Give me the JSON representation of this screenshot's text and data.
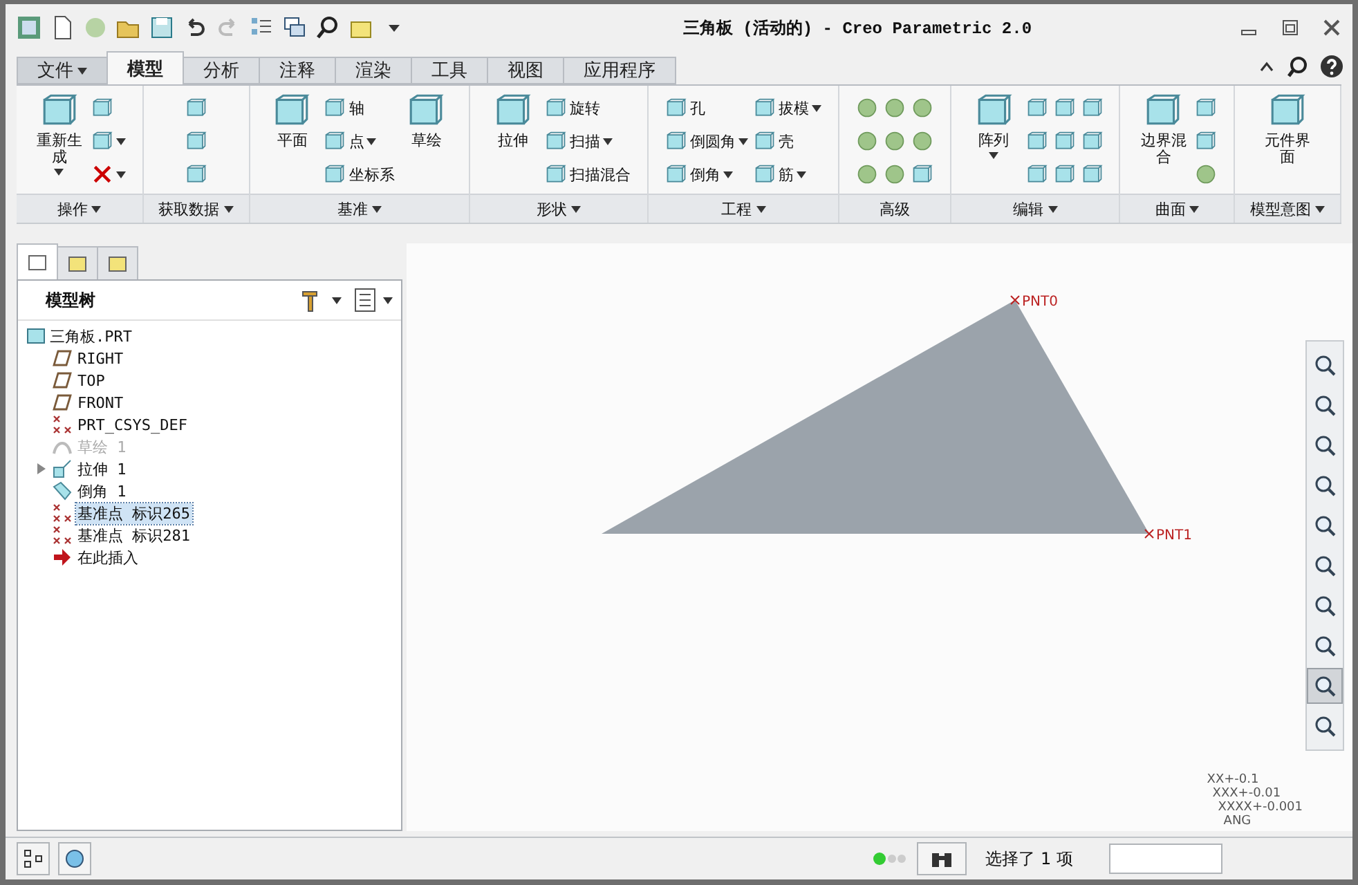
{
  "window": {
    "title": "三角板 (活动的) - Creo Parametric 2.0"
  },
  "menu_tabs": [
    {
      "label": "文件",
      "kind": "menu",
      "selected": false
    },
    {
      "label": "模型",
      "kind": "tab",
      "selected": true
    },
    {
      "label": "分析",
      "kind": "tab",
      "selected": false
    },
    {
      "label": "注释",
      "kind": "tab",
      "selected": false
    },
    {
      "label": "渲染",
      "kind": "tab",
      "selected": false
    },
    {
      "label": "工具",
      "kind": "tab",
      "selected": false
    },
    {
      "label": "视图",
      "kind": "tab",
      "selected": false
    },
    {
      "label": "应用程序",
      "kind": "tab",
      "selected": false
    }
  ],
  "ribbon_groups": [
    {
      "label": "操作",
      "dropdown": true,
      "items": [
        {
          "kind": "large",
          "label": "重新生成",
          "dropdown": true
        },
        {
          "kind": "icon",
          "dropdown": false
        },
        {
          "kind": "icon",
          "dropdown": true
        },
        {
          "kind": "delete",
          "dropdown": true
        }
      ]
    },
    {
      "label": "获取数据",
      "dropdown": true,
      "items": [
        {
          "kind": "icon",
          "dropdown": false
        },
        {
          "kind": "icon",
          "dropdown": false
        },
        {
          "kind": "icon",
          "dropdown": false
        }
      ]
    },
    {
      "label": "基准",
      "dropdown": true,
      "items": [
        {
          "kind": "large",
          "label": "平面",
          "dropdown": false
        },
        {
          "kind": "small",
          "label": "轴",
          "dropdown": false
        },
        {
          "kind": "small",
          "label": "点",
          "dropdown": true
        },
        {
          "kind": "small",
          "label": "坐标系",
          "dropdown": false
        },
        {
          "kind": "large",
          "label": "草绘",
          "dropdown": false
        }
      ]
    },
    {
      "label": "形状",
      "dropdown": true,
      "items": [
        {
          "kind": "large",
          "label": "拉伸",
          "dropdown": false
        },
        {
          "kind": "small",
          "label": "旋转",
          "dropdown": false
        },
        {
          "kind": "small",
          "label": "扫描",
          "dropdown": true
        },
        {
          "kind": "small",
          "label": "扫描混合",
          "dropdown": false
        }
      ]
    },
    {
      "label": "工程",
      "dropdown": true,
      "items": [
        {
          "kind": "small",
          "label": "孔",
          "dropdown": false
        },
        {
          "kind": "small",
          "label": "倒圆角",
          "dropdown": true
        },
        {
          "kind": "small",
          "label": "倒角",
          "dropdown": true
        },
        {
          "kind": "small",
          "label": "拔模",
          "dropdown": true
        },
        {
          "kind": "small",
          "label": "壳",
          "dropdown": false
        },
        {
          "kind": "small",
          "label": "筋",
          "dropdown": true
        }
      ]
    },
    {
      "label": "高级",
      "dropdown": false,
      "items": [
        {
          "kind": "ball",
          "dropdown": false
        },
        {
          "kind": "ball",
          "dropdown": false
        },
        {
          "kind": "ball",
          "dropdown": false
        },
        {
          "kind": "ball",
          "dropdown": false
        },
        {
          "kind": "ball",
          "dropdown": false
        },
        {
          "kind": "ball",
          "dropdown": false
        },
        {
          "kind": "ball",
          "dropdown": false
        },
        {
          "kind": "ball",
          "dropdown": false
        },
        {
          "kind": "icon",
          "dropdown": false
        }
      ]
    },
    {
      "label": "编辑",
      "dropdown": true,
      "items": [
        {
          "kind": "large",
          "label": "阵列",
          "dropdown": true
        },
        {
          "kind": "icon",
          "dropdown": false
        },
        {
          "kind": "icon",
          "dropdown": false
        },
        {
          "kind": "icon",
          "dropdown": false
        },
        {
          "kind": "icon",
          "dropdown": false
        },
        {
          "kind": "icon",
          "dropdown": false
        },
        {
          "kind": "icon",
          "dropdown": false
        },
        {
          "kind": "icon",
          "dropdown": false
        },
        {
          "kind": "icon",
          "dropdown": false
        },
        {
          "kind": "icon",
          "dropdown": false
        }
      ]
    },
    {
      "label": "曲面",
      "dropdown": true,
      "items": [
        {
          "kind": "large",
          "label": "边界混合",
          "dropdown": false
        },
        {
          "kind": "icon",
          "dropdown": false
        },
        {
          "kind": "icon",
          "dropdown": false
        },
        {
          "kind": "ball",
          "dropdown": false
        }
      ]
    },
    {
      "label": "模型意图",
      "dropdown": true,
      "items": [
        {
          "kind": "large",
          "label": "元件界面",
          "dropdown": false
        }
      ]
    }
  ],
  "navigator_tabs": [
    {
      "selected": true
    },
    {
      "selected": false
    },
    {
      "selected": false
    }
  ],
  "model_tree": {
    "title": "模型树",
    "root": {
      "label": "三角板.PRT",
      "children": [
        {
          "kind": "plane",
          "label": "RIGHT",
          "dimmed": false,
          "expandable": false,
          "selected": false
        },
        {
          "kind": "plane",
          "label": "TOP",
          "dimmed": false,
          "expandable": false,
          "selected": false
        },
        {
          "kind": "plane",
          "label": "FRONT",
          "dimmed": false,
          "expandable": false,
          "selected": false
        },
        {
          "kind": "csys",
          "label": "PRT_CSYS_DEF",
          "dimmed": false,
          "expandable": false,
          "selected": false
        },
        {
          "kind": "sketch",
          "label": "草绘 1",
          "dimmed": true,
          "expandable": false,
          "selected": false
        },
        {
          "kind": "extrude",
          "label": "拉伸 1",
          "dimmed": false,
          "expandable": true,
          "selected": false
        },
        {
          "kind": "chamfer",
          "label": "倒角 1",
          "dimmed": false,
          "expandable": false,
          "selected": false
        },
        {
          "kind": "point",
          "label": "基准点 标识265",
          "dimmed": false,
          "expandable": false,
          "selected": true
        },
        {
          "kind": "point",
          "label": "基准点 标识281",
          "dimmed": false,
          "expandable": false,
          "selected": false
        },
        {
          "kind": "insert",
          "label": "在此插入",
          "dimmed": false,
          "expandable": false,
          "selected": false
        }
      ]
    }
  },
  "graphics": {
    "points": [
      {
        "label": "PNT0"
      },
      {
        "label": "PNT1"
      }
    ],
    "view_tools": [
      {
        "selected": false
      },
      {
        "selected": false
      },
      {
        "selected": false
      },
      {
        "selected": false
      },
      {
        "selected": false
      },
      {
        "selected": false
      },
      {
        "selected": false
      },
      {
        "selected": false
      },
      {
        "selected": true
      },
      {
        "selected": false
      }
    ],
    "tolerances": [
      "XX+-0.1",
      "XXX+-0.01",
      "XXXX+-0.001",
      "ANG"
    ]
  },
  "status_bar": {
    "message": "选择了 1 项"
  }
}
